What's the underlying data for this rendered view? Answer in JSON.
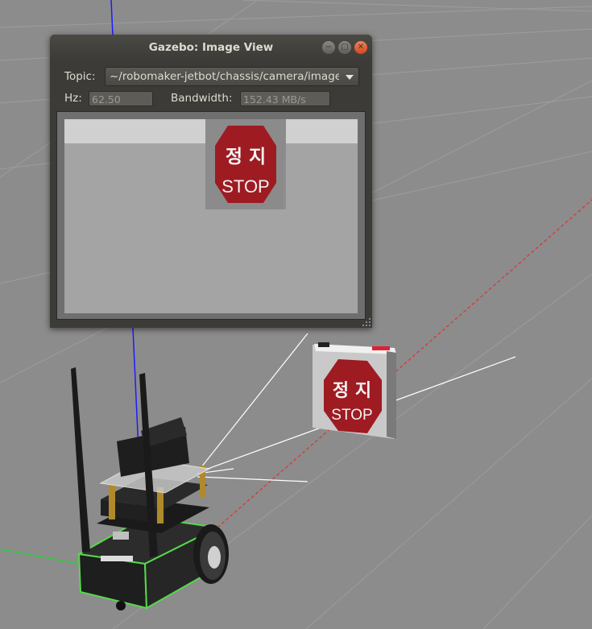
{
  "window": {
    "title": "Gazebo: Image View",
    "minimize_icon": "minimize-icon",
    "maximize_icon": "maximize-icon",
    "close_icon": "close-icon"
  },
  "topic": {
    "label": "Topic:",
    "value": "~/robomaker-jetbot/chassis/camera/image"
  },
  "hz": {
    "label": "Hz:",
    "value": "62.50"
  },
  "bandwidth": {
    "label": "Bandwidth:",
    "value": "152.43 MB/s"
  },
  "sign": {
    "text_ko": "정 지",
    "text_en": "STOP"
  },
  "colors": {
    "ground": "#8c8c8c",
    "window_bg": "#3c3b37",
    "close_button": "#e2572a",
    "stop_sign": "#9e1b22",
    "robot_frame": "#56d94a",
    "z_axis": "#1c1cff",
    "ray": "#ffffff"
  }
}
